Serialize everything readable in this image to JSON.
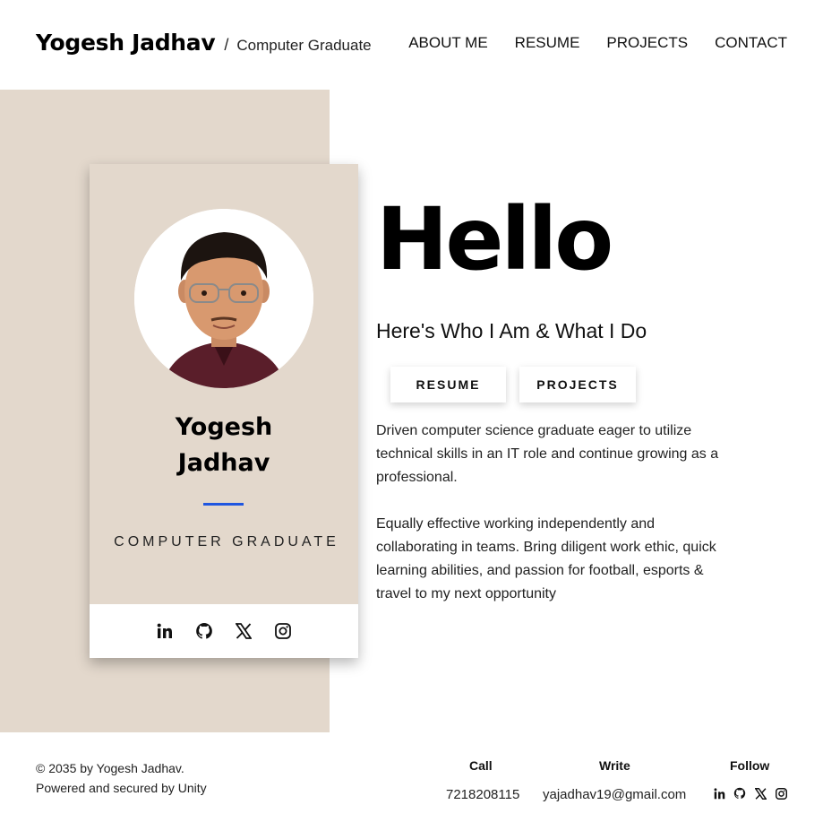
{
  "header": {
    "name": "Yogesh Jadhav",
    "separator": "/",
    "role": "Computer Graduate",
    "nav": [
      "ABOUT ME",
      "RESUME",
      "PROJECTS",
      "CONTACT"
    ]
  },
  "card": {
    "name_line1": "Yogesh",
    "name_line2": "Jadhav",
    "role": "COMPUTER GRADUATE",
    "social_icons": [
      "linkedin-icon",
      "github-icon",
      "x-icon",
      "instagram-icon"
    ]
  },
  "hero": {
    "greeting": "Hello",
    "subtitle": "Here's Who I Am & What I Do",
    "buttons": [
      "RESUME",
      "PROJECTS"
    ],
    "paragraph1": "Driven computer science graduate eager to utilize technical skills in an IT role and continue growing as a professional.",
    "paragraph2": "Equally effective working independently and collaborating in teams. Bring diligent work ethic, quick learning abilities, and passion for football, esports & travel to my next opportunity"
  },
  "footer": {
    "copyright": "© 2035 by Yogesh Jadhav.",
    "powered": "Powered and secured by Unity",
    "call_label": "Call",
    "call_value": "7218208115",
    "write_label": "Write",
    "write_value": "yajadhav19@gmail.com",
    "follow_label": "Follow",
    "social_icons": [
      "linkedin-icon",
      "github-icon",
      "x-icon",
      "instagram-icon"
    ]
  },
  "colors": {
    "beige": "#e3d8cc",
    "accent_blue": "#1f56e0",
    "text": "#111111"
  }
}
